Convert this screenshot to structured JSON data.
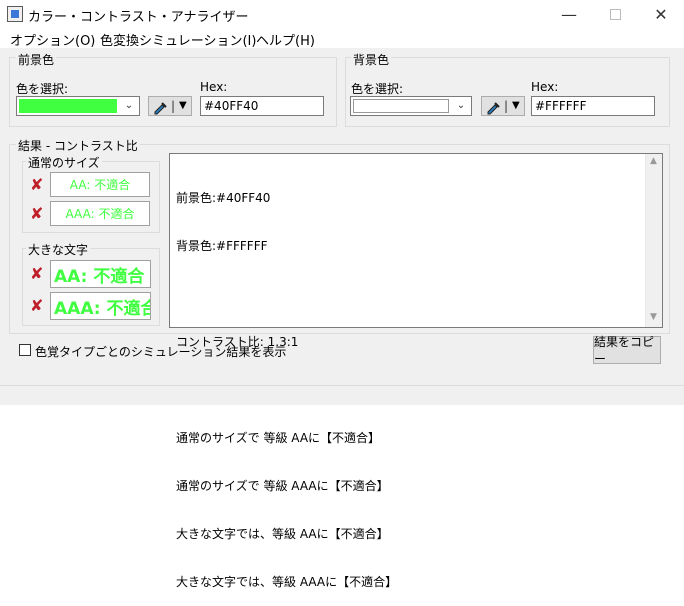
{
  "window": {
    "title": "カラー・コントラスト・アナライザー"
  },
  "menu": {
    "options": "オプション(O)",
    "simulation": "色変換シミュレーション(I)",
    "help": "ヘルプ(H)"
  },
  "foreground": {
    "group_label": "前景色",
    "select_label": "色を選択:",
    "hex_label": "Hex:",
    "hex_value": "#40FF40",
    "swatch_color": "#40FF40"
  },
  "background": {
    "group_label": "背景色",
    "select_label": "色を選択:",
    "hex_label": "Hex:",
    "hex_value": "#FFFFFF",
    "swatch_color": "#FFFFFF"
  },
  "results": {
    "group_label": "結果 - コントラスト比",
    "normal_label": "通常のサイズ",
    "large_label": "大きな文字",
    "normal_aa": "AA: 不適合",
    "normal_aaa": "AAA: 不適合",
    "large_aa": "AA: 不適合",
    "large_aaa": "AAA: 不適合",
    "report_lines": [
      "前景色:#40FF40",
      "背景色:#FFFFFF",
      "",
      "コントラスト比: 1.3:1",
      "",
      "通常のサイズで 等級 AAに【不適合】",
      "通常のサイズで 等級 AAAに【不適合】",
      "大きな文字では、等級 AAに【不適合】",
      "大きな文字では、等級 AAAに【不適合】"
    ]
  },
  "footer": {
    "checkbox_label": "色覚タイプごとのシミュレーション結果を表示",
    "copy_button": "結果をコピー"
  },
  "colors": {
    "fail": "#C0202A",
    "foreground_sample": "#40FF40"
  }
}
